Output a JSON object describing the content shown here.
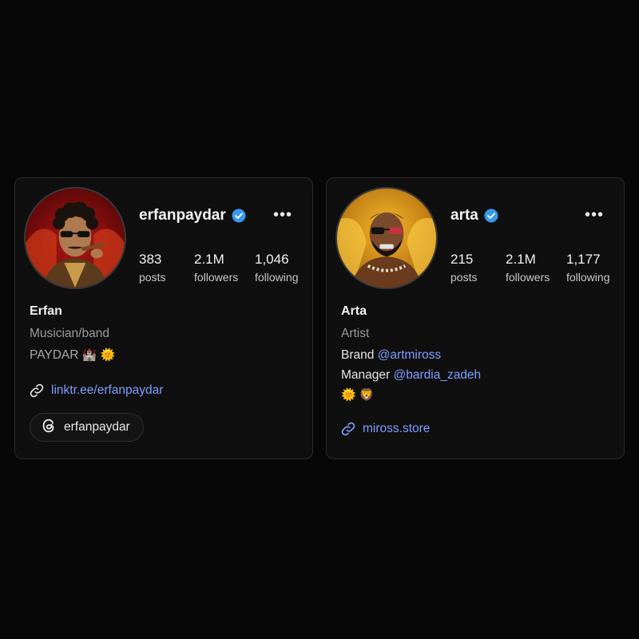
{
  "profiles": [
    {
      "username": "erfanpaydar",
      "verified": true,
      "stats": [
        {
          "value": "383",
          "label": "posts"
        },
        {
          "value": "2.1M",
          "label": "followers"
        },
        {
          "value": "1,046",
          "label": "following"
        }
      ],
      "name": "Erfan",
      "category": "Musician/band",
      "bio_text": "PAYDAR",
      "bio_emojis": "🏰 🌞",
      "link": "linktr.ee/erfanpaydar",
      "threads_handle": "erfanpaydar"
    },
    {
      "username": "arta",
      "verified": true,
      "stats": [
        {
          "value": "215",
          "label": "posts"
        },
        {
          "value": "2.1M",
          "label": "followers"
        },
        {
          "value": "1,177",
          "label": "following"
        }
      ],
      "name": "Arta",
      "category": "Artist",
      "bio_line1_prefix": "Brand",
      "bio_line1_mention": "@artmiross",
      "bio_line2_prefix": "Manager",
      "bio_line2_mention": "@bardia_zadeh",
      "bio_emojis": "🌞 🦁",
      "link": "miross.store"
    }
  ],
  "colors": {
    "background": "#070707",
    "card": "#0f0f0f",
    "link": "#7f9eff",
    "verified": "#3897f0"
  },
  "icons": [
    "verified-badge-icon",
    "more-options-icon",
    "link-icon",
    "threads-icon"
  ]
}
